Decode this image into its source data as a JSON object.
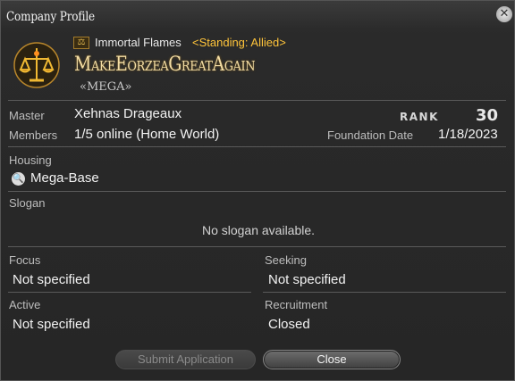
{
  "window": {
    "title": "Company Profile"
  },
  "header": {
    "grand_company": "Immortal Flames",
    "standing": "<Standing: Allied>",
    "fc_name": "MakeEorzeaGreatAgain",
    "fc_tag": "«MEGA»"
  },
  "info": {
    "master_label": "Master",
    "master_value": "Xehnas Drageaux",
    "rank_label": "RANK",
    "rank_value": "30",
    "members_label": "Members",
    "members_value": "1/5 online (Home World)",
    "foundation_label": "Foundation Date",
    "foundation_value": "1/18/2023"
  },
  "housing": {
    "label": "Housing",
    "value": "Mega-Base"
  },
  "slogan": {
    "label": "Slogan",
    "value": "No slogan available."
  },
  "focus": {
    "label": "Focus",
    "value": "Not specified"
  },
  "seeking": {
    "label": "Seeking",
    "value": "Not specified"
  },
  "active": {
    "label": "Active",
    "value": "Not specified"
  },
  "recruitment": {
    "label": "Recruitment",
    "value": "Closed"
  },
  "buttons": {
    "submit": "Submit Application",
    "close": "Close"
  },
  "icons": {
    "close": "close-icon",
    "emblem": "company-crest-icon",
    "grand_company": "grand-company-icon",
    "housing": "magnifier-icon"
  },
  "colors": {
    "standing": "#ffc43a",
    "fc_name": "#f3dda4"
  }
}
